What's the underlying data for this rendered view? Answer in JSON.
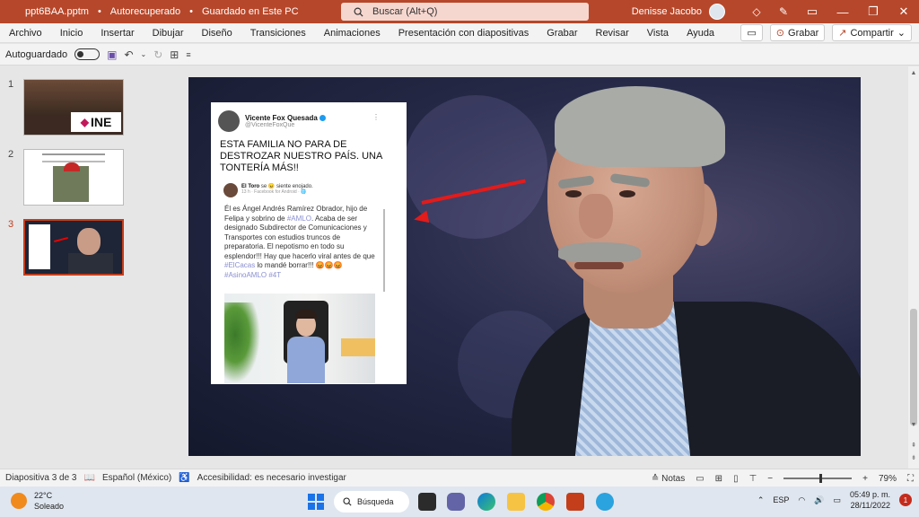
{
  "titlebar": {
    "file_name": "ppt6BAA.pptm",
    "status": "Autorecuperado",
    "saved": "Guardado en Este PC",
    "separator": "•",
    "search_placeholder": "Buscar (Alt+Q)",
    "user_name": "Denisse Jacobo"
  },
  "ribbon": {
    "tabs": [
      "Archivo",
      "Inicio",
      "Insertar",
      "Dibujar",
      "Diseño",
      "Transiciones",
      "Animaciones",
      "Presentación con diapositivas",
      "Grabar",
      "Revisar",
      "Vista",
      "Ayuda"
    ],
    "record_label": "Grabar",
    "share_label": "Compartir"
  },
  "qat": {
    "autosave_label": "Autoguardado"
  },
  "thumbnails": [
    {
      "number": "1",
      "logo_text": "INE"
    },
    {
      "number": "2"
    },
    {
      "number": "3"
    }
  ],
  "tweet": {
    "name": "Vicente Fox Quesada",
    "handle": "@VicenteFoxQue",
    "text": "ESTA FAMILIA NO PARA DE DESTROZAR NUESTRO PAÍS. UNA TONTERÍA MÁS!!",
    "embedded_post": {
      "author": "El Toro",
      "feeling": "se 😠 siente enojado.",
      "meta": "13 h · Facebook for Android · 🌐",
      "text_1": "Él es Ángel Andrés Ramírez Obrador, hijo de Felipa y sobrino de ",
      "tag_1": "#AMLO",
      "text_2": ". Acaba de ser designado Subdirector de Comunicaciones y Transportes con estudios truncos de preparatoria. El nepotismo en todo su esplendor!!! Hay que hacerlo viral antes de que ",
      "tag_2": "#ElCacas",
      "text_3": " lo mandé borrar!!! 😡😡😡 ",
      "tag_3": "#AsinoAMLO #4T"
    }
  },
  "statusbar": {
    "slide_indicator": "Diapositiva 3 de 3",
    "language": "Español (México)",
    "accessibility": "Accesibilidad: es necesario investigar",
    "notes_label": "Notas",
    "zoom": "79%"
  },
  "taskbar": {
    "temperature": "22°C",
    "weather": "Soleado",
    "search_label": "Búsqueda",
    "input_language": "ESP",
    "time": "05:49 p. m.",
    "date": "28/11/2022",
    "notification_count": "1"
  },
  "colors": {
    "accent": "#b7472a",
    "selected_thumb": "#c43e1c",
    "arrow": "#e21b1b"
  }
}
